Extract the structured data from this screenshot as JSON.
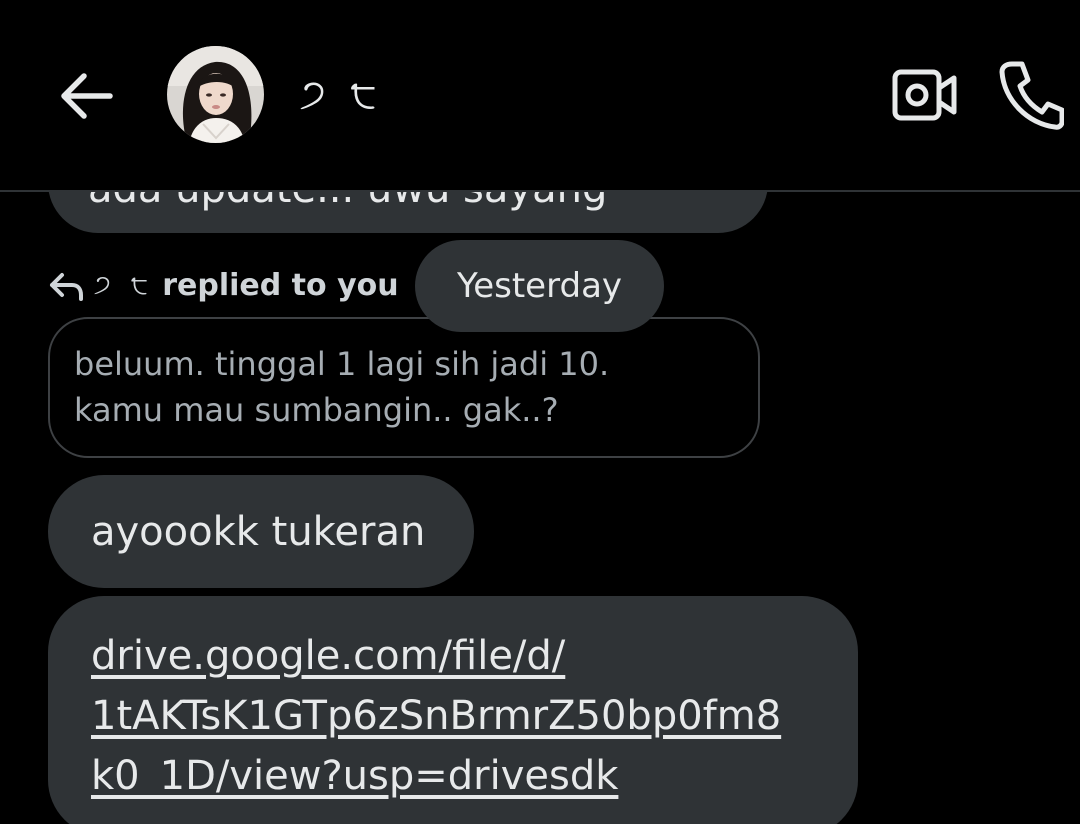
{
  "header": {
    "contact_name": "੭ ੮",
    "back_label": "Back",
    "video_label": "Video call",
    "call_label": "Voice call"
  },
  "messages": {
    "previous_partial": "ada update... uwu sayang",
    "reply_context": {
      "name": "੭ ੮",
      "suffix": "replied to you"
    },
    "date_separator": "Yesterday",
    "quoted_text": {
      "line1": "beluum. tinggal 1 lagi sih jadi 10.",
      "line2": "kamu mau sumbangin.. gak..?"
    },
    "msg1": "ayoookk tukeran",
    "link": {
      "line1": "drive.google.com/file/d/",
      "line2": "1tAKTsK1GTp6zSnBrmrZ50bp0fm8",
      "line3": "k0_1D/view?usp=drivesdk"
    }
  },
  "colors": {
    "background": "#000000",
    "bubble": "#2f3336",
    "text": "#e7e9ea",
    "muted_text": "#a6adb3",
    "divider": "#2f3336"
  },
  "icons": [
    "arrow-left-icon",
    "video-camera-icon",
    "phone-icon",
    "reply-arrow-icon"
  ]
}
